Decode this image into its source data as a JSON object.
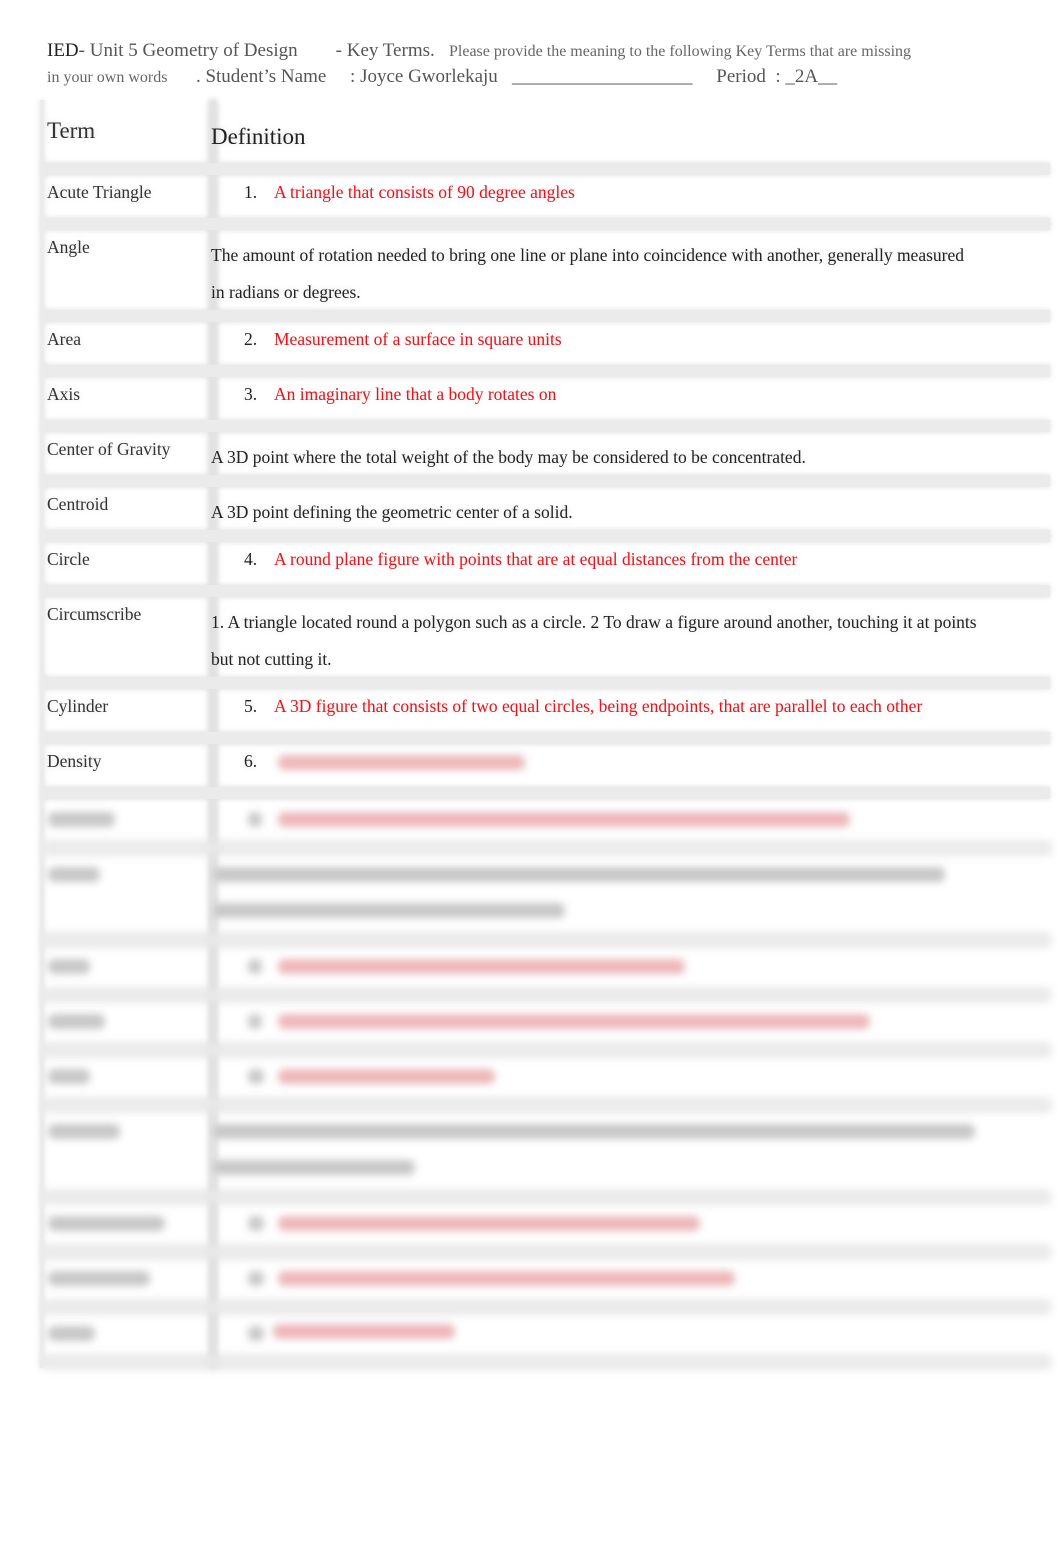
{
  "header": {
    "course": "IED",
    "unit": "- Unit 5 Geometry of Design",
    "key_terms": "- Key Terms.",
    "instruction": "Please provide the meaning to the following Key Terms that are missing",
    "instruction_cont": "in your own words",
    "student_label": ". Student’s Name",
    "student_name": ": Joyce Gworlekaju",
    "blank": "___________________",
    "period_label": "Period",
    "period_value": ": _2A__"
  },
  "table": {
    "headers": {
      "term": "Term",
      "definition": "Definition"
    },
    "rows": [
      {
        "term": "Acute Triangle",
        "num": "1.",
        "answer": "A triangle that consists of 90 degree angles"
      },
      {
        "term": "Angle",
        "definition": "The amount of rotation needed to bring one line or plane into coincidence with another, generally measured in radians or degrees."
      },
      {
        "term": "Area",
        "num": "2.",
        "answer": "Measurement of a surface in square units"
      },
      {
        "term": "Axis",
        "num": "3.",
        "answer": "An imaginary line that a body rotates on"
      },
      {
        "term": "Center of Gravity",
        "definition": "A 3D point where the total weight of the body may be considered to be concentrated."
      },
      {
        "term": "Centroid",
        "definition": "A 3D point defining the geometric center of a solid."
      },
      {
        "term": "Circle",
        "num": "4.",
        "answer": "A round plane figure with points that are at equal distances from the center"
      },
      {
        "term": "Circumscribe",
        "definition": "1. A triangle located round a polygon such as a circle. 2 To draw a figure around another, touching it at points but not cutting it."
      },
      {
        "term": "Cylinder",
        "num": "5.",
        "answer": "A 3D figure that consists of two equal circles, being endpoints, that are parallel to each other"
      },
      {
        "term": "Density",
        "num": "6."
      }
    ]
  },
  "colors": {
    "answer": "#e8141b",
    "separator": "#ebebeb"
  }
}
